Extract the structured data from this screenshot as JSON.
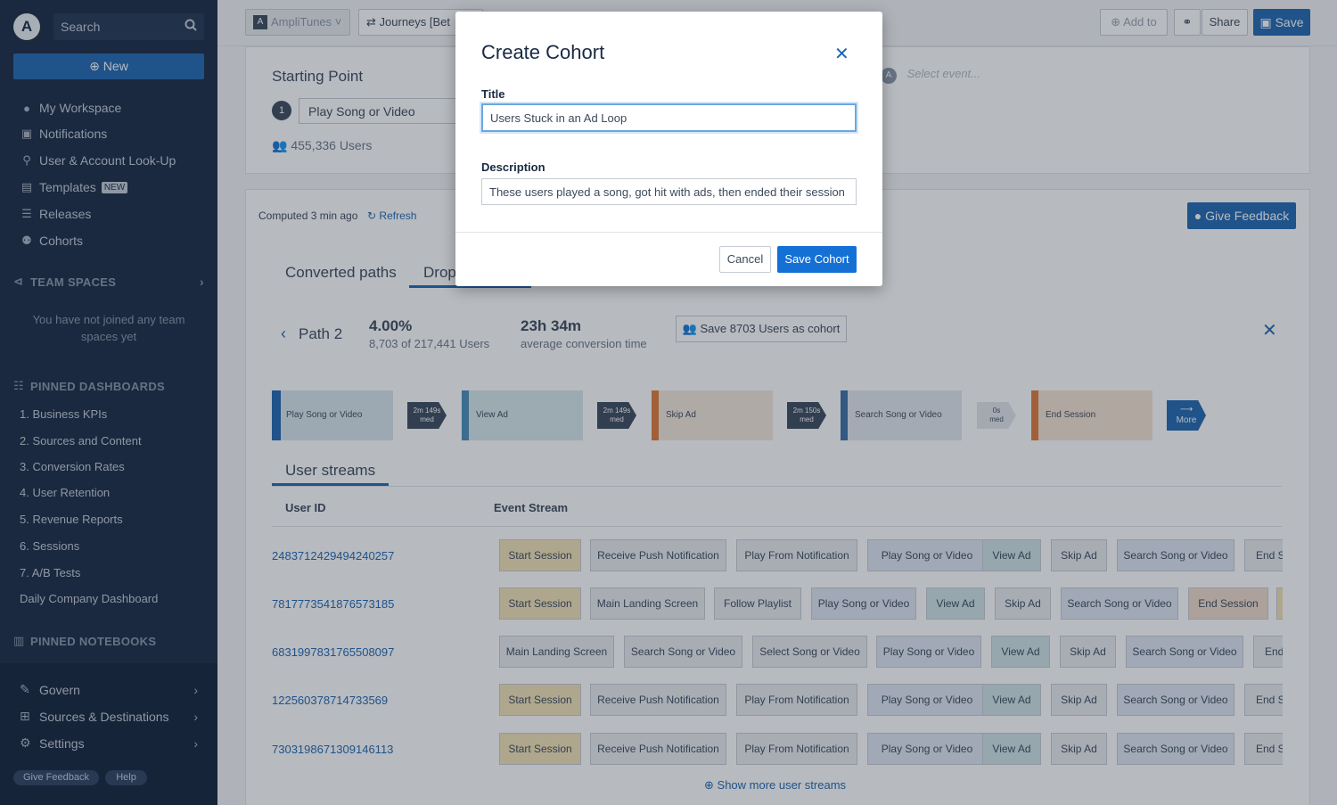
{
  "sidebar": {
    "logo_letter": "A",
    "search_label": "Search",
    "new_label": "New",
    "nav": [
      {
        "label": "My Workspace",
        "icon": "user-icon"
      },
      {
        "label": "Notifications",
        "icon": "bell-icon"
      },
      {
        "label": "User & Account Look-Up",
        "icon": "user-search-icon"
      },
      {
        "label": "Templates",
        "icon": "template-icon",
        "badge": "NEW"
      },
      {
        "label": "Releases",
        "icon": "releases-icon"
      },
      {
        "label": "Cohorts",
        "icon": "cohorts-icon"
      }
    ],
    "team_spaces_title": "TEAM SPACES",
    "team_spaces_empty": "You have not joined any team spaces yet",
    "pinned_dashboards_title": "PINNED DASHBOARDS",
    "pinned_dashboards": [
      "1. Business KPIs",
      "2. Sources and Content",
      "3. Conversion Rates",
      "4. User Retention",
      "5. Revenue Reports",
      "6. Sessions",
      "7. A/B Tests",
      "Daily Company Dashboard"
    ],
    "pinned_notebooks_title": "PINNED NOTEBOOKS",
    "bottom": [
      {
        "label": "Govern",
        "icon": "wrench-icon"
      },
      {
        "label": "Sources & Destinations",
        "icon": "sources-icon"
      },
      {
        "label": "Settings",
        "icon": "gear-icon"
      }
    ],
    "give_feedback_label": "Give Feedback",
    "help_label": "Help"
  },
  "topbar": {
    "project_letter": "A",
    "project_name": "AmpliTunes",
    "journeys_label": "Journeys [Bet",
    "add_to_label": "Add to",
    "share_label": "Share",
    "save_label": "Save"
  },
  "starting_point": {
    "title": "Starting Point",
    "step_number": "1",
    "event": "Play Song or Video",
    "users": "455,336 Users",
    "select_event_avatar": "A",
    "select_event_placeholder": "Select event..."
  },
  "results": {
    "computed": "Computed 3 min ago",
    "refresh_label": "Refresh",
    "give_feedback_label": "Give Feedback",
    "tabs": [
      "Converted paths",
      "Drop"
    ],
    "path_label": "Path 2",
    "conversion_pct": "4.00%",
    "conversion_users": "8,703 of 217,441 Users",
    "avg_time": "23h 34m",
    "avg_time_label": "average conversion time",
    "save_cohort_label": "Save 8703 Users as cohort",
    "flow_nodes": [
      {
        "label": "Play Song or Video",
        "color": "#1f67b1",
        "bg": "#d7e6ee"
      },
      {
        "label": "View Ad",
        "color": "#4a8db8",
        "bg": "#d7e8ea"
      },
      {
        "label": "Skip Ad",
        "color": "#e07b39",
        "bg": "#f5e7dc"
      },
      {
        "label": "Search Song or Video",
        "color": "#3d6fa5",
        "bg": "#e3e8ee"
      },
      {
        "label": "End Session",
        "color": "#e07b39",
        "bg": "#f6e3d3"
      }
    ],
    "flow_arrows": [
      {
        "line1": "2m 149s",
        "line2": "med"
      },
      {
        "line1": "2m 149s",
        "line2": "med"
      },
      {
        "line1": "2m 150s",
        "line2": "med"
      },
      {
        "line1": "0s",
        "line2": "med"
      }
    ],
    "more_label": "More"
  },
  "user_streams": {
    "title": "User streams",
    "col_user": "User ID",
    "col_stream": "Event Stream",
    "rows": [
      {
        "id": "2483712429494240257",
        "events": [
          "Start Session",
          "Receive Push Notification",
          "Play From Notification",
          "Play Song or Video",
          "View Ad",
          "Skip Ad",
          "Search Song or Video",
          "End Session"
        ]
      },
      {
        "id": "7817773541876573185",
        "events": [
          "Start Session",
          "Main Landing Screen",
          "Follow Playlist",
          "Play Song or Video",
          "View Ad",
          "Skip Ad",
          "Search Song or Video",
          "End Session",
          ""
        ]
      },
      {
        "id": "6831997831765508097",
        "events": [
          "Main Landing Screen",
          "Search Song or Video",
          "Select Song or Video",
          "Play Song or Video",
          "View Ad",
          "Skip Ad",
          "Search Song or Video",
          "End Session"
        ]
      },
      {
        "id": "122560378714733569",
        "events": [
          "Start Session",
          "Receive Push Notification",
          "Play From Notification",
          "Play Song or Video",
          "View Ad",
          "Skip Ad",
          "Search Song or Video",
          "End Session"
        ]
      },
      {
        "id": "7303198671309146113",
        "events": [
          "Start Session",
          "Receive Push Notification",
          "Play From Notification",
          "Play Song or Video",
          "View Ad",
          "Skip Ad",
          "Search Song or Video",
          "End Session"
        ]
      }
    ],
    "show_more": "Show more user streams"
  },
  "modal": {
    "title": "Create Cohort",
    "title_label": "Title",
    "title_value": "Users Stuck in an Ad Loop",
    "description_label": "Description",
    "description_value": "These users played a song, got hit with ads, then ended their session",
    "cancel_label": "Cancel",
    "save_label": "Save Cohort"
  },
  "colors": {
    "accent": "#1f67b1",
    "sidebar_bg": "#182a43",
    "chip_yellow": "#f3e3b6",
    "chip_teal": "#cfe3e6",
    "chip_blue": "#dde6f0",
    "chip_gray": "#e9ecef",
    "chip_orange": "#f0dccb"
  }
}
